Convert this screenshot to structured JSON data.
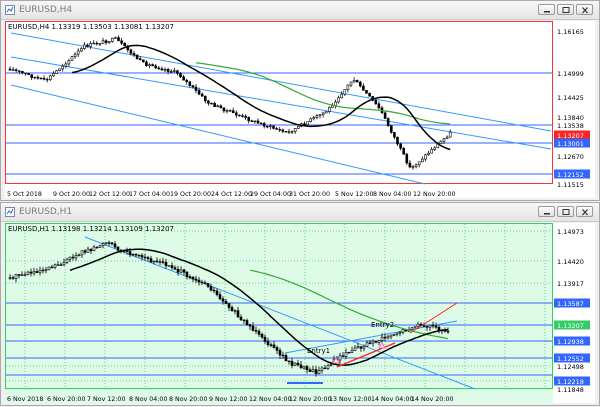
{
  "windows": [
    {
      "title": "EURUSD,H4",
      "header": "EURUSD,H4  1.13319 1.13503 1.13081 1.13207",
      "bg": "#ffffff",
      "frame": "#ff3333",
      "price_labels": [
        "1.16165",
        "1.14999",
        "1.14425",
        "1.13840",
        "1.13538",
        "1.13207",
        "1.13001",
        "1.12670",
        "1.12152",
        "1.11515"
      ],
      "time_labels": [
        "5 Oct 2018",
        "9 Oct 20:00",
        "12 Oct 12:00",
        "17 Oct 04:00",
        "19 Oct 20:00",
        "24 Oct 12:00",
        "29 Oct 04:00",
        "31 Oct 20:00",
        "5 Nov 12:00",
        "8 Nov 04:00",
        "12 Nov 20:00"
      ]
    },
    {
      "title": "EURUSD,H1",
      "header": "EURUSD,H1  1.13198 1.13214 1.13109 1.13207",
      "bg": "#ddfbe7",
      "frame": "#33cc66",
      "price_labels": [
        "1.14973",
        "1.14420",
        "1.13917",
        "1.13587",
        "1.13207",
        "1.12938",
        "1.12552",
        "1.12498",
        "1.12218",
        "1.11848"
      ],
      "time_labels": [
        "6 Nov 2018",
        "6 Nov 20:00",
        "7 Nov 12:00",
        "8 Nov 04:00",
        "8 Nov 20:00",
        "9 Nov 12:00",
        "12 Nov 04:00",
        "12 Nov 20:00",
        "13 Nov 12:00",
        "14 Nov 04:00",
        "14 Nov 20:00"
      ],
      "annotations": [
        "Entry1",
        "Entry2"
      ]
    }
  ],
  "colors": {
    "candle": "#000000",
    "ma_fast": "#000000",
    "ma_slow": "#33aa33",
    "channel": "#3399ff",
    "hline": "#3366ff",
    "red_tag": "#ff2222",
    "blue_tag": "#3366ff"
  },
  "icons": [
    "chart-window-icon",
    "minimize-icon",
    "maximize-icon",
    "close-icon"
  ]
}
